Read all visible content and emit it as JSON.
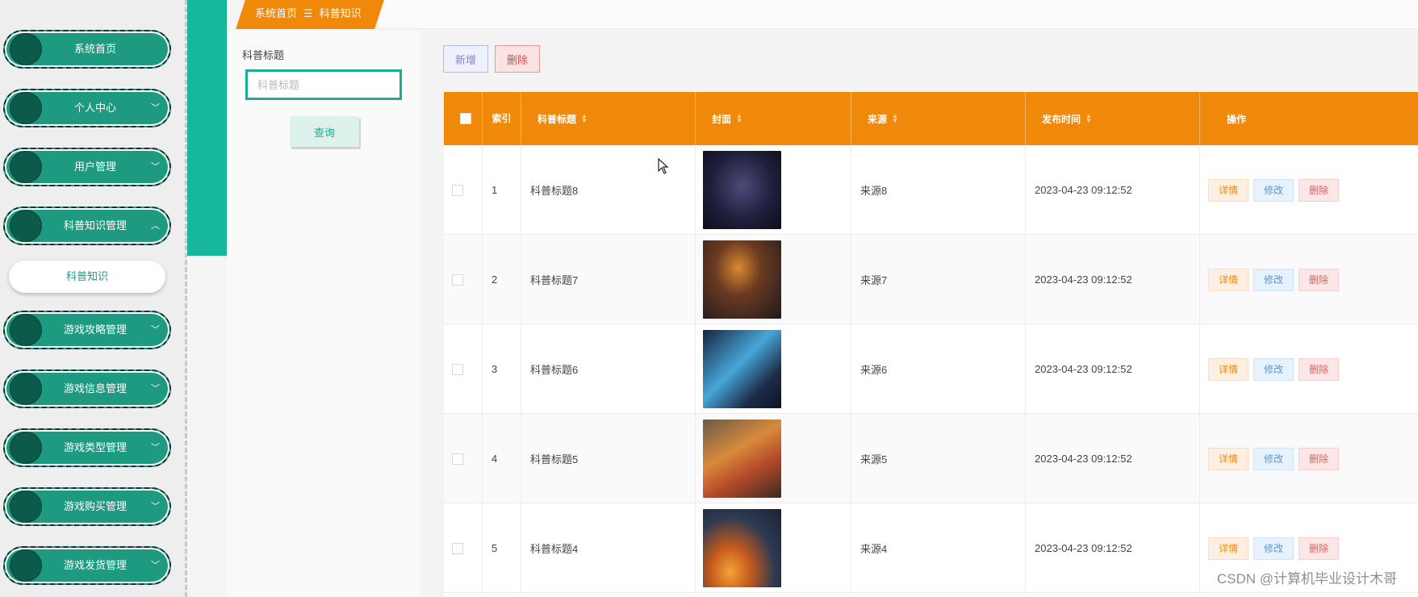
{
  "breadcrumb": {
    "home": "系统首页",
    "separator": "☰",
    "current": "科普知识"
  },
  "sidebar": {
    "items": [
      {
        "label": "系统首页",
        "chevron": ""
      },
      {
        "label": "个人中心",
        "chevron": "﹀"
      },
      {
        "label": "用户管理",
        "chevron": "﹀"
      },
      {
        "label": "科普知识管理",
        "chevron": "︿"
      },
      {
        "label": "游戏攻略管理",
        "chevron": "﹀"
      },
      {
        "label": "游戏信息管理",
        "chevron": "﹀"
      },
      {
        "label": "游戏类型管理",
        "chevron": "﹀"
      },
      {
        "label": "游戏购买管理",
        "chevron": "﹀"
      },
      {
        "label": "游戏发货管理",
        "chevron": "﹀"
      }
    ],
    "submenu": {
      "label": "科普知识"
    }
  },
  "search": {
    "label": "科普标题",
    "placeholder": "科普标题",
    "value": "",
    "button": "查询"
  },
  "toolbar": {
    "add_label": "新增",
    "delete_label": "删除"
  },
  "table": {
    "columns": [
      {
        "label": ""
      },
      {
        "label": "索引"
      },
      {
        "label": "科普标题",
        "sortable": true
      },
      {
        "label": "封面",
        "sortable": true
      },
      {
        "label": "来源",
        "sortable": true
      },
      {
        "label": "发布时间",
        "sortable": true
      },
      {
        "label": "操作"
      }
    ],
    "rows": [
      {
        "index": "1",
        "title": "科普标题8",
        "source": "来源8",
        "time": "2023-04-23 09:12:52"
      },
      {
        "index": "2",
        "title": "科普标题7",
        "source": "来源7",
        "time": "2023-04-23 09:12:52"
      },
      {
        "index": "3",
        "title": "科普标题6",
        "source": "来源6",
        "time": "2023-04-23 09:12:52"
      },
      {
        "index": "4",
        "title": "科普标题5",
        "source": "来源5",
        "time": "2023-04-23 09:12:52"
      },
      {
        "index": "5",
        "title": "科普标题4",
        "source": "来源4",
        "time": "2023-04-23 09:12:52"
      }
    ],
    "actions": {
      "detail": "详情",
      "edit": "修改",
      "delete": "删除"
    }
  },
  "colors": {
    "accent": "#f0890a",
    "teal": "#1aab91",
    "sidebar_item": "#1d9a80"
  },
  "watermark": "CSDN @计算机毕业设计木哥"
}
